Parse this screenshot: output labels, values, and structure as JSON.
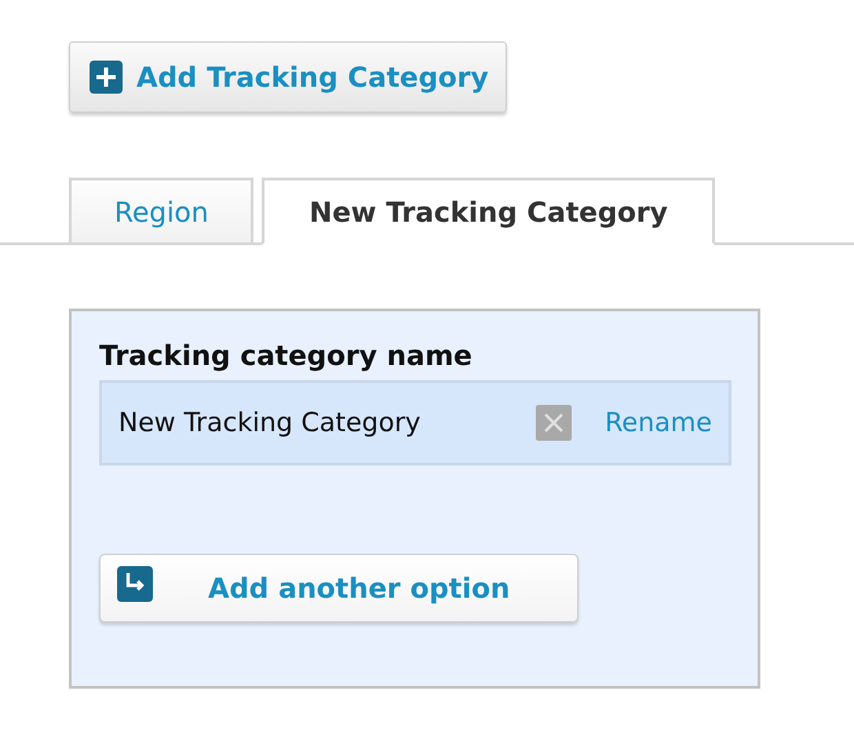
{
  "add_button": {
    "label": "Add Tracking Category"
  },
  "tabs": [
    {
      "label": "Region",
      "selected": false
    },
    {
      "label": "New Tracking Category",
      "selected": true
    }
  ],
  "panel": {
    "heading": "Tracking category name",
    "name_value": "New Tracking Category",
    "rename_link": "Rename",
    "add_option_button": {
      "label": "Add another option"
    }
  }
}
